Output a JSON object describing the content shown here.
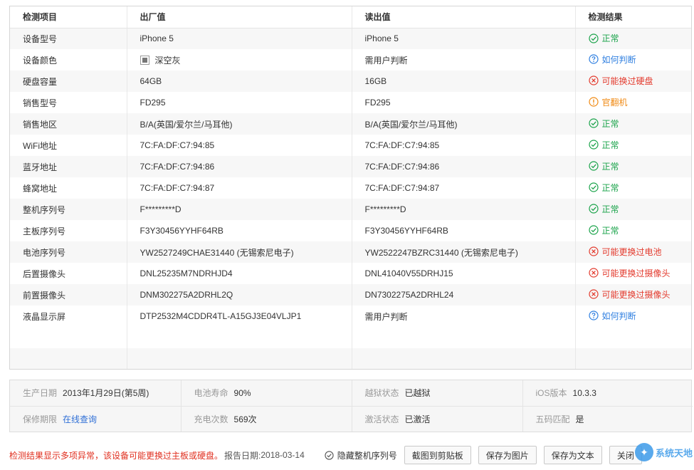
{
  "table": {
    "headers": {
      "item": "检测项目",
      "factory": "出厂值",
      "read": "读出值",
      "result": "检测结果"
    },
    "rows": [
      {
        "item": "设备型号",
        "factory": "iPhone 5",
        "read": "iPhone 5",
        "status": "ok",
        "result": "正常"
      },
      {
        "item": "设备颜色",
        "factory": "深空灰",
        "read": "需用户判断",
        "status": "help",
        "result": "如何判断"
      },
      {
        "item": "硬盘容量",
        "factory": "64GB",
        "read": "16GB",
        "status": "bad",
        "result": "可能换过硬盘"
      },
      {
        "item": "销售型号",
        "factory": "FD295",
        "read": "FD295",
        "status": "warn",
        "result": "官翻机"
      },
      {
        "item": "销售地区",
        "factory": "B/A(英国/爱尔兰/马耳他)",
        "read": "B/A(英国/爱尔兰/马耳他)",
        "status": "ok",
        "result": "正常"
      },
      {
        "item": "WiFi地址",
        "factory": "7C:FA:DF:C7:94:85",
        "read": "7C:FA:DF:C7:94:85",
        "status": "ok",
        "result": "正常"
      },
      {
        "item": "蓝牙地址",
        "factory": "7C:FA:DF:C7:94:86",
        "read": "7C:FA:DF:C7:94:86",
        "status": "ok",
        "result": "正常"
      },
      {
        "item": "蜂窝地址",
        "factory": "7C:FA:DF:C7:94:87",
        "read": "7C:FA:DF:C7:94:87",
        "status": "ok",
        "result": "正常"
      },
      {
        "item": "整机序列号",
        "factory": "F*********D",
        "read": "F*********D",
        "status": "ok",
        "result": "正常"
      },
      {
        "item": "主板序列号",
        "factory": "F3Y30456YYHF64RB",
        "read": "F3Y30456YYHF64RB",
        "status": "ok",
        "result": "正常"
      },
      {
        "item": "电池序列号",
        "factory": "YW2527249CHAE31440 (无锡索尼电子)",
        "read": "YW2522247BZRC31440 (无锡索尼电子)",
        "status": "bad",
        "result": "可能更换过电池"
      },
      {
        "item": "后置摄像头",
        "factory": "DNL25235M7NDRHJD4",
        "read": "DNL41040V55DRHJ15",
        "status": "bad",
        "result": "可能更换过摄像头"
      },
      {
        "item": "前置摄像头",
        "factory": "DNM302275A2DRHL2Q",
        "read": "DN7302275A2DRHL24",
        "status": "bad",
        "result": "可能更换过摄像头"
      },
      {
        "item": "液晶显示屏",
        "factory": "DTP2532M4CDDR4TL-A15GJ3E04VLJP1",
        "read": "需用户判断",
        "status": "help",
        "result": "如何判断"
      }
    ]
  },
  "info": {
    "production_date_label": "生产日期",
    "production_date": "2013年1月29日(第5周)",
    "battery_life_label": "电池寿命",
    "battery_life": "90%",
    "jailbreak_label": "越狱状态",
    "jailbreak": "已越狱",
    "ios_label": "iOS版本",
    "ios": "10.3.3",
    "warranty_label": "保修期限",
    "warranty_link": "在线查询",
    "charge_count_label": "充电次数",
    "charge_count": "569次",
    "activation_label": "激活状态",
    "activation": "已激活",
    "five_code_label": "五码匹配",
    "five_code": "是"
  },
  "footer": {
    "warning": "检测结果显示多项异常，该设备可能更换过主板或硬盘。",
    "report_label": "报告日期:",
    "report_date": "2018-03-14",
    "hide_serial_label": "隐藏整机序列号",
    "copy_button": "截图到剪贴板",
    "save_image_button": "保存为图片",
    "save_text_button": "保存为文本",
    "close_button": "关闭"
  },
  "watermark": {
    "text": "系统天地"
  },
  "colors": {
    "ok": "#1aa34a",
    "bad": "#e33b2e",
    "help": "#2f7fe0",
    "warn": "#f08a14"
  },
  "icons": {
    "ok": "check-circle-icon",
    "bad": "x-circle-icon",
    "help": "question-circle-icon",
    "warn": "exclamation-circle-icon"
  }
}
